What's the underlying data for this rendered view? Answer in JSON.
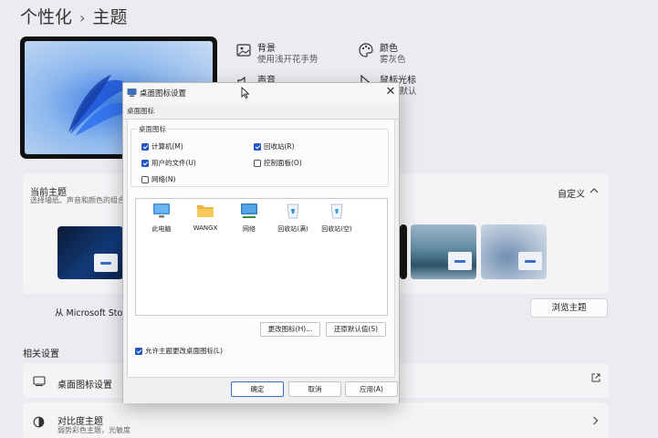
{
  "breadcrumb": {
    "parent": "个性化",
    "separator": "›",
    "current": "主题"
  },
  "settings": {
    "background": {
      "title": "背景",
      "subtitle": "使用浅开花手势"
    },
    "color": {
      "title": "颜色",
      "subtitle": "雾灰色"
    },
    "sound": {
      "title": "声音"
    },
    "cursor": {
      "title": "鼠标光标",
      "subtitle": "ows 默认"
    }
  },
  "current_theme": {
    "title": "当前主题",
    "subtitle": "选择墙纸、声音和颜色的组合",
    "customize": "自定义",
    "store_text": "从 Microsoft Store",
    "browse_button": "浏览主题"
  },
  "related": {
    "heading": "相关设置",
    "desktop_icons": "桌面图标设置",
    "contrast_title": "对比度主题",
    "contrast_sub": "弱势彩色主题，光敏度"
  },
  "dialog": {
    "title": "桌面图标设置",
    "close_glyph": "✕",
    "tab": "桌面图标",
    "group_label": "桌面图标",
    "checkboxes": {
      "computer": {
        "label": "计算机(M)",
        "checked": true
      },
      "recycle": {
        "label": "回收站(R)",
        "checked": true
      },
      "user_files": {
        "label": "用户的文件(U)",
        "checked": true
      },
      "control_panel": {
        "label": "控制面板(O)",
        "checked": false
      },
      "network": {
        "label": "网络(N)",
        "checked": false
      }
    },
    "icons": [
      "此电脑",
      "WANGX",
      "网络",
      "回收站(满)",
      "回收站(空)"
    ],
    "change_icon_button": "更改图标(H)...",
    "restore_default_button": "还原默认值(S)",
    "allow_themes_label": "允许主题更改桌面图标(L)",
    "allow_themes_checked": true,
    "ok_button": "确定",
    "cancel_button": "取消",
    "apply_button": "应用(A)"
  },
  "colors": {
    "accent": "#2256c3"
  }
}
